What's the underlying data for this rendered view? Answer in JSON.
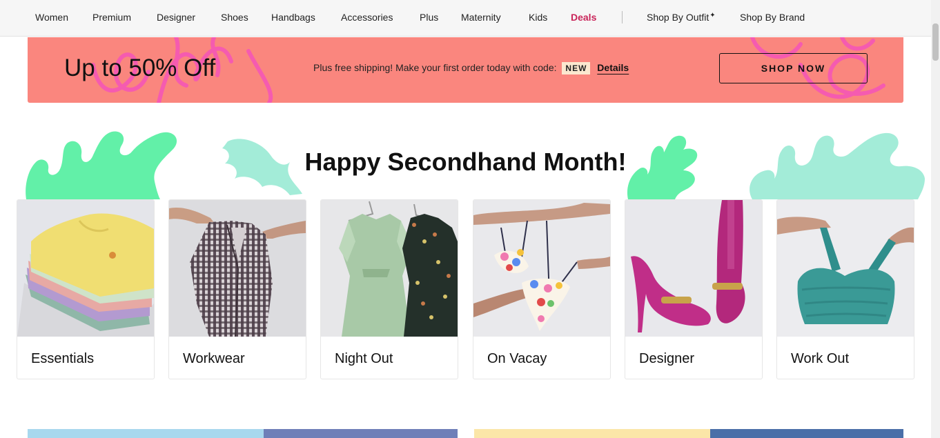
{
  "nav": {
    "items": [
      "Women",
      "Premium",
      "Designer",
      "Shoes",
      "Handbags",
      "Accessories",
      "Plus",
      "Maternity",
      "Kids",
      "Deals"
    ],
    "outfit": "Shop By Outfit",
    "outfit_icon": "sparkle-icon",
    "brand": "Shop By Brand",
    "deals_color": "#c92459"
  },
  "promo": {
    "headline": "Up to 50% Off",
    "subtext": "Plus free shipping! Make your first order today with code:",
    "code": "NEW",
    "details": "Details",
    "cta": "SHOP NOW",
    "background": "#fa867e",
    "doodle_color": "#f55bb0"
  },
  "section": {
    "title": "Happy Secondhand Month!",
    "leaf_colors": [
      "#62f0a8",
      "#a3ecd8"
    ]
  },
  "categories": [
    {
      "label": "Essentials",
      "image": "folded-tshirts-image"
    },
    {
      "label": "Workwear",
      "image": "checked-blazer-image"
    },
    {
      "label": "Night Out",
      "image": "dresses-on-hangers-image"
    },
    {
      "label": "On Vacay",
      "image": "floral-bikini-image"
    },
    {
      "label": "Designer",
      "image": "magenta-heels-image"
    },
    {
      "label": "Work Out",
      "image": "sports-bra-image"
    }
  ]
}
